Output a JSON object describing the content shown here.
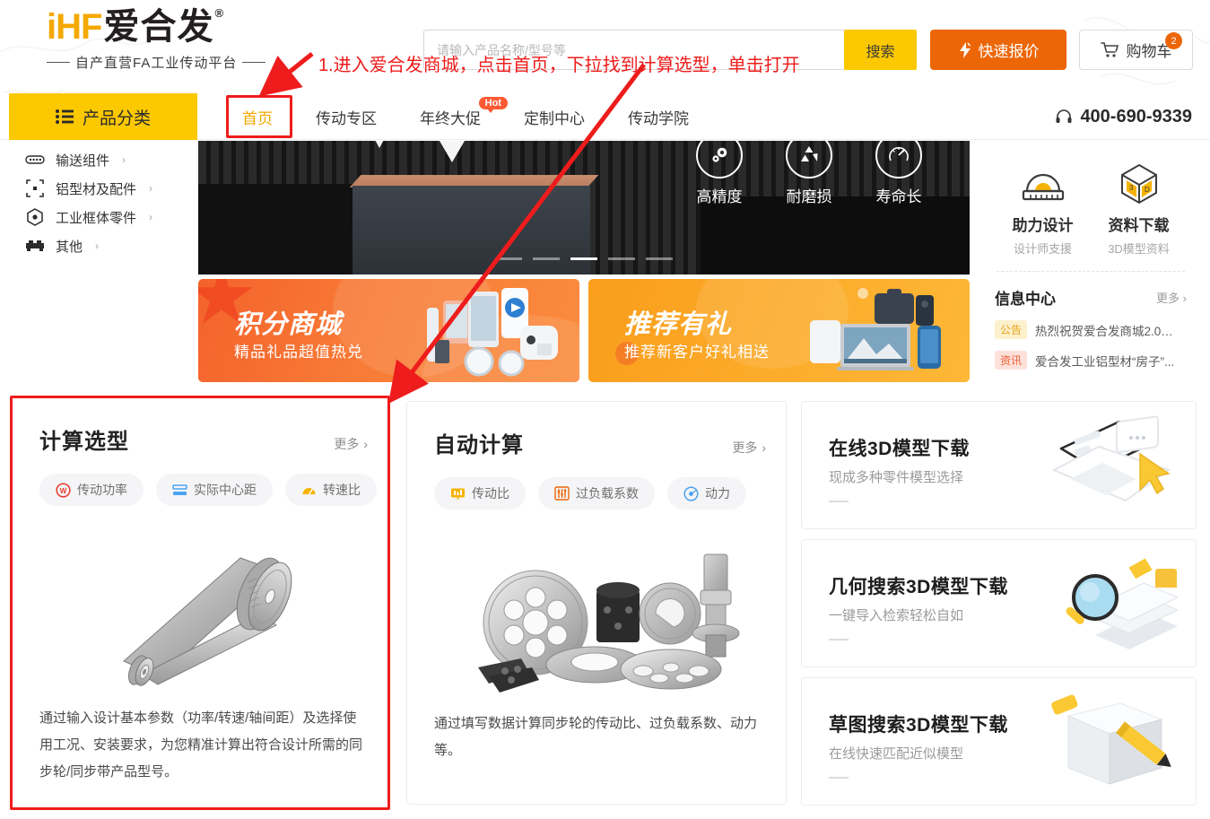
{
  "header": {
    "logo_i": "i",
    "logo_hf": "HF",
    "logo_cn": "爱合发",
    "logo_reg": "®",
    "logo_tagline": "自产直营FA工业传动平台",
    "search_placeholder": "请输入产品名称/型号等",
    "search_value": "",
    "search_button": "搜索",
    "quote_button": "快速报价",
    "cart_button": "购物车",
    "cart_count": "2"
  },
  "nav": {
    "category_button": "产品分类",
    "items": [
      {
        "label": "首页",
        "active": true,
        "badge": ""
      },
      {
        "label": "传动专区",
        "active": false,
        "badge": ""
      },
      {
        "label": "年终大促",
        "active": false,
        "badge": "Hot"
      },
      {
        "label": "定制中心",
        "active": false,
        "badge": ""
      },
      {
        "label": "传动学院",
        "active": false,
        "badge": ""
      }
    ],
    "telephone": "400-690-9339"
  },
  "category_panel": {
    "items": [
      {
        "label": "输送组件",
        "icon": "conveyor-icon"
      },
      {
        "label": "铝型材及配件",
        "icon": "profile-icon"
      },
      {
        "label": "工业框体零件",
        "icon": "frame-part-icon"
      },
      {
        "label": "其他",
        "icon": "other-icon"
      }
    ],
    "chevron": "›"
  },
  "banner": {
    "features": [
      {
        "label": "高精度",
        "icon": "gear-icon"
      },
      {
        "label": "耐磨损",
        "icon": "recycle-icon"
      },
      {
        "label": "寿命长",
        "icon": "gauge-icon"
      }
    ],
    "dots_count": 5,
    "active_dot": 3
  },
  "promos": [
    {
      "title": "积分商城",
      "subtitle": "精品礼品超值热兑",
      "accent": "#f4622c"
    },
    {
      "title": "推荐有礼",
      "subtitle": "推荐新客户好礼相送",
      "accent": "#fa9d1c"
    }
  ],
  "cards": [
    {
      "title": "计算选型",
      "more": "更多",
      "chips": [
        {
          "label": "传动功率",
          "icon": "power-icon",
          "color": "#e8392f"
        },
        {
          "label": "实际中心距",
          "icon": "distance-icon",
          "color": "#4aa3f0"
        },
        {
          "label": "转速比",
          "icon": "speed-ratio-icon",
          "color": "#f5b200"
        }
      ],
      "image": "timing-belt-pulley-illustration",
      "description": "通过输入设计基本参数（功率/转速/轴间距）及选择使用工况、安装要求，为您精准计算出符合设计所需的同步轮/同步带产品型号。",
      "highlighted": true
    },
    {
      "title": "自动计算",
      "more": "更多",
      "chips": [
        {
          "label": "传动比",
          "icon": "ratio-icon",
          "color": "#f5b200"
        },
        {
          "label": "过负载系数",
          "icon": "overload-icon",
          "color": "#ec6608"
        },
        {
          "label": "动力",
          "icon": "power-dot-icon",
          "color": "#4aa3f0"
        }
      ],
      "image": "gears-assortment-illustration",
      "description": "通过填写数据计算同步轮的传动比、过负载系数、动力等。",
      "highlighted": false
    }
  ],
  "right_cards": [
    {
      "title": "在线3D模型下载",
      "subtitle": "现成多种零件模型选择",
      "icon": "laptop-cursor-icon"
    },
    {
      "title": "几何搜索3D模型下载",
      "subtitle": "一键导入检索轻松自如",
      "icon": "magnifier-books-icon"
    },
    {
      "title": "草图搜索3D模型下载",
      "subtitle": "在线快速匹配近似模型",
      "icon": "cube-pencil-icon"
    }
  ],
  "right_sidebar": {
    "shortcuts": [
      {
        "title": "助力设计",
        "subtitle": "设计师支援",
        "icon": "protractor-icon"
      },
      {
        "title": "资料下载",
        "subtitle": "3D模型资料",
        "icon": "cube-3d-icon"
      }
    ],
    "news_title": "信息中心",
    "news_more": "更多",
    "news": [
      {
        "tag": "公告",
        "tag_style": "yellow",
        "text": "热烈祝贺爱合发商城2.0版..."
      },
      {
        "tag": "资讯",
        "tag_style": "red",
        "text": "爱合发工业铝型材“房子”..."
      }
    ]
  },
  "annotation": {
    "text": "1.进入爱合发商城，点击首页，下拉找到计算选型，单击打开",
    "color": "#ee1c1c"
  }
}
